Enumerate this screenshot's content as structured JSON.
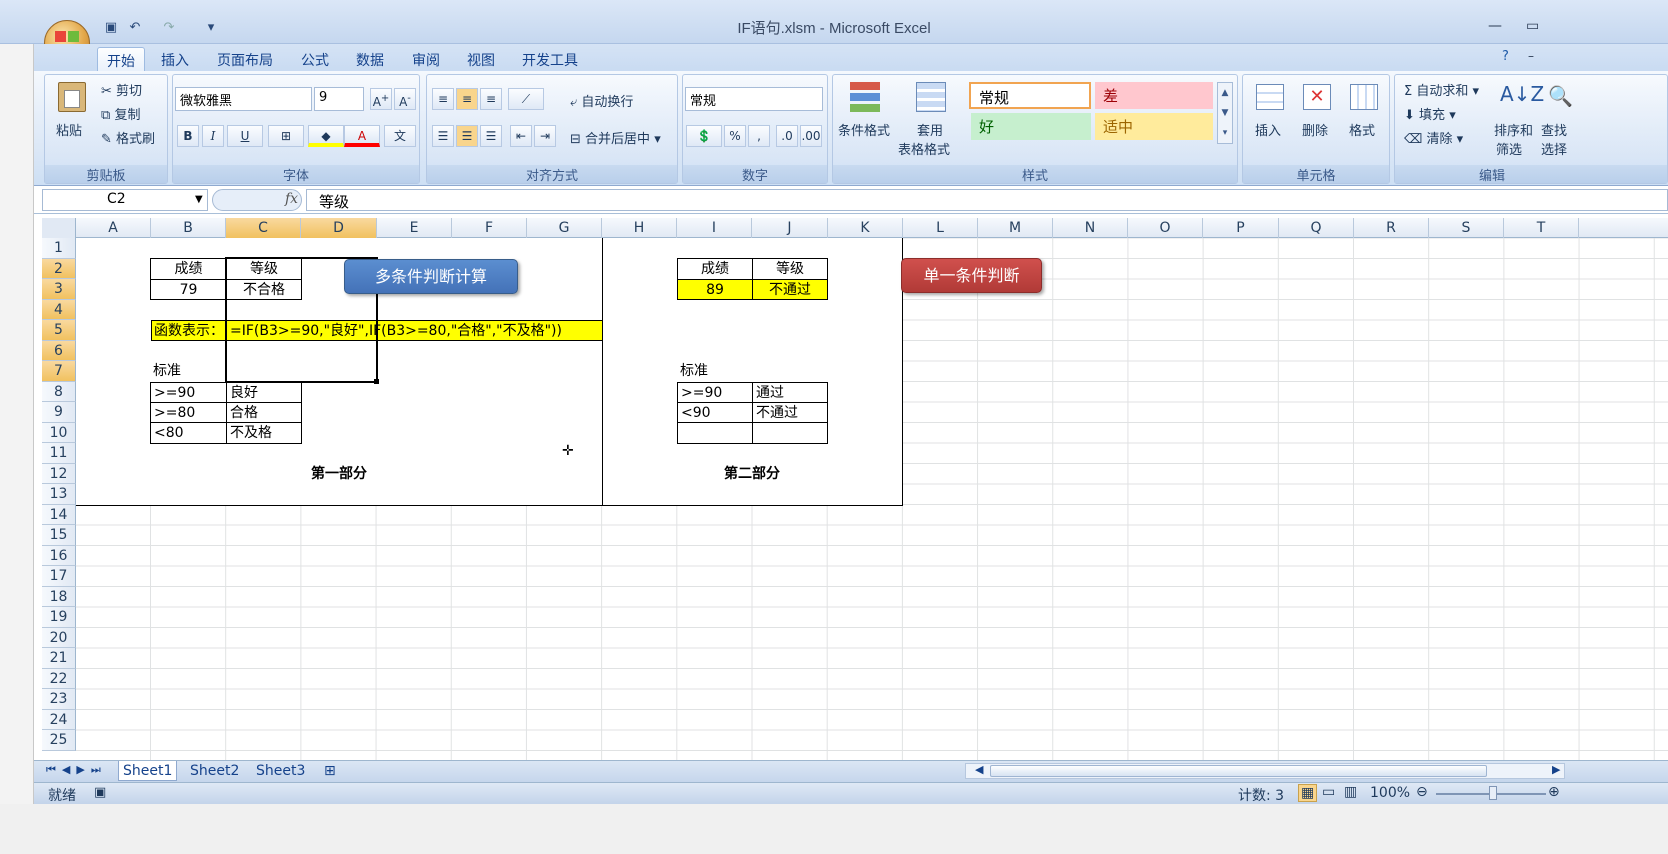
{
  "app": {
    "title": "IF语句.xlsm - Microsoft Excel"
  },
  "ribbon_tabs": [
    "开始",
    "插入",
    "页面布局",
    "公式",
    "数据",
    "审阅",
    "视图",
    "开发工具"
  ],
  "clipboard": {
    "paste": "粘贴",
    "cut": "剪切",
    "copy": "复制",
    "format_painter": "格式刷",
    "label": "剪贴板"
  },
  "font": {
    "name": "微软雅黑",
    "size": "9",
    "label": "字体",
    "bold": "B",
    "italic": "I",
    "underline": "U"
  },
  "alignment": {
    "wrap": "自动换行",
    "merge": "合并后居中",
    "label": "对齐方式"
  },
  "number": {
    "format": "常规",
    "percent": "%",
    "comma": ",",
    "label": "数字"
  },
  "styles": {
    "conditional": "条件格式",
    "table_top": "套用",
    "table_bottom": "表格格式",
    "normal": "常规",
    "bad": "差",
    "good": "好",
    "neutral": "适中",
    "label": "样式",
    "color_bad": "#ffc7ce",
    "color_good": "#c6efce",
    "color_neutral": "#ffeb9c"
  },
  "cells": {
    "insert": "插入",
    "delete": "删除",
    "format": "格式",
    "label": "单元格"
  },
  "editing": {
    "autosum": "自动求和",
    "fill": "填充",
    "clear": "清除",
    "sort_top": "排序和",
    "sort_bottom": "筛选",
    "find_top": "查找",
    "find_bottom": "选择",
    "label": "编辑"
  },
  "formula_bar": {
    "name_box": "C2",
    "fx": "fx",
    "content": "等级"
  },
  "columns": [
    "A",
    "B",
    "C",
    "D",
    "E",
    "F",
    "G",
    "H",
    "I",
    "J",
    "K",
    "L",
    "M",
    "N",
    "O",
    "P",
    "Q",
    "R",
    "S",
    "T"
  ],
  "rows": [
    "1",
    "2",
    "3",
    "4",
    "5",
    "6",
    "7",
    "8",
    "9",
    "10",
    "11",
    "12",
    "13",
    "14",
    "15",
    "16",
    "17",
    "18",
    "19",
    "20",
    "21",
    "22",
    "23",
    "24",
    "25"
  ],
  "part1": {
    "score_header": "成绩",
    "grade_header": "等级",
    "score": "79",
    "grade": "不合格",
    "func_label": "函数表示：",
    "formula": "=IF(B3>=90,\"良好\",IF(B3>=80,\"合格\",\"不及格\"))",
    "standard": "标准",
    "rules": [
      [
        ">=90",
        "良好"
      ],
      [
        ">=80",
        "合格"
      ],
      [
        "<80",
        "不及格"
      ]
    ],
    "title": "第一部分",
    "button": "多条件判断计算"
  },
  "part2": {
    "score_header": "成绩",
    "grade_header": "等级",
    "score": "89",
    "grade": "不通过",
    "standard": "标准",
    "rules": [
      [
        ">=90",
        "通过"
      ],
      [
        "<90",
        "不通过"
      ]
    ],
    "title": "第二部分",
    "button": "单一条件判断"
  },
  "sheets": [
    "Sheet1",
    "Sheet2",
    "Sheet3"
  ],
  "status": {
    "ready": "就绪",
    "count": "计数: 3",
    "zoom": "100%"
  }
}
